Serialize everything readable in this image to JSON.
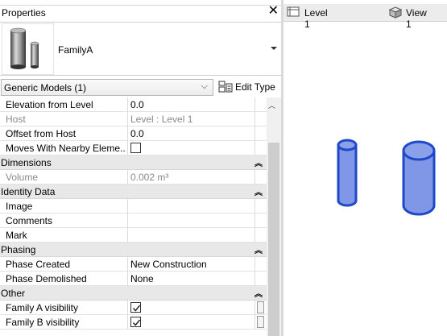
{
  "properties": {
    "title": "Properties",
    "close_glyph": "✕",
    "type_selector": {
      "family_name": "FamilyA"
    },
    "filter": {
      "selected": "Generic Models (1)"
    },
    "edit_type_label": "Edit Type",
    "rows": [
      {
        "kind": "row",
        "name": "Elevation from Level",
        "value": "0.0"
      },
      {
        "kind": "row",
        "name": "Host",
        "value": "Level : Level 1",
        "grey": true
      },
      {
        "kind": "row",
        "name": "Offset from Host",
        "value": "0.0"
      },
      {
        "kind": "check",
        "name": "Moves With Nearby Eleme...",
        "checked": false
      },
      {
        "kind": "group",
        "name": "Dimensions"
      },
      {
        "kind": "row",
        "name": "Volume",
        "value": "0.002 m³",
        "grey": true
      },
      {
        "kind": "group",
        "name": "Identity Data"
      },
      {
        "kind": "row",
        "name": "Image",
        "value": ""
      },
      {
        "kind": "row",
        "name": "Comments",
        "value": ""
      },
      {
        "kind": "row",
        "name": "Mark",
        "value": ""
      },
      {
        "kind": "group",
        "name": "Phasing"
      },
      {
        "kind": "row",
        "name": "Phase Created",
        "value": "New Construction"
      },
      {
        "kind": "row",
        "name": "Phase Demolished",
        "value": "None"
      },
      {
        "kind": "group",
        "name": "Other"
      },
      {
        "kind": "check",
        "name": "Family A visibility",
        "checked": true,
        "handle": true
      },
      {
        "kind": "check",
        "name": "Family B visibility",
        "checked": true,
        "handle": true
      }
    ]
  },
  "viewport": {
    "tabs": [
      {
        "label": "Level 1",
        "icon": "floor-plan-icon"
      },
      {
        "label": "View 1",
        "icon": "3d-view-icon"
      }
    ],
    "accent_color": "#1f49c9",
    "fill_color": "#7f97e6"
  }
}
